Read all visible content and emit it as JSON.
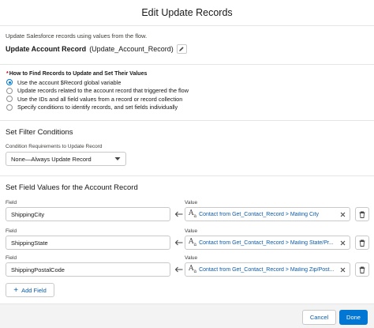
{
  "modal": {
    "title": "Edit Update Records"
  },
  "intro_text": "Update Salesforce records using values from the flow.",
  "element": {
    "label": "Update Account Record",
    "api_name": "(Update_Account_Record)"
  },
  "find_records": {
    "required_marker": "*",
    "label": "How to Find Records to Update and Set Their Values",
    "options": [
      {
        "label": "Use the account $Record global variable",
        "selected": true
      },
      {
        "label": "Update records related to the account record that triggered the flow",
        "selected": false
      },
      {
        "label": "Use the IDs and all field values from a record or record collection",
        "selected": false
      },
      {
        "label": "Specify conditions to identify records, and set fields individually",
        "selected": false
      }
    ]
  },
  "filter": {
    "title": "Set Filter Conditions",
    "condition_label": "Condition Requirements to Update Record",
    "condition_value": "None—Always Update Record"
  },
  "field_values": {
    "title": "Set Field Values for the Account Record",
    "field_label": "Field",
    "value_label": "Value",
    "rows": [
      {
        "field": "ShippingCity",
        "value": "Contact from Get_Contact_Record > Mailing City"
      },
      {
        "field": "ShippingState",
        "value": "Contact from Get_Contact_Record > Mailing State/Pr..."
      },
      {
        "field": "ShippingPostalCode",
        "value": "Contact from Get_Contact_Record > Mailing Zip/Post..."
      }
    ],
    "add_field_label": "Add Field"
  },
  "footer": {
    "cancel_label": "Cancel",
    "done_label": "Done"
  },
  "colors": {
    "brand": "#0176d3",
    "link": "#0b5cab",
    "border": "#c9c9c9",
    "required": "#ba0517"
  },
  "icons": {
    "edit": "pencil-icon",
    "text_type": "text-aa-icon",
    "clear": "close-icon",
    "delete": "trash-icon",
    "arrow": "arrow-left-icon",
    "dropdown": "chevron-down-icon",
    "add": "plus-icon"
  }
}
